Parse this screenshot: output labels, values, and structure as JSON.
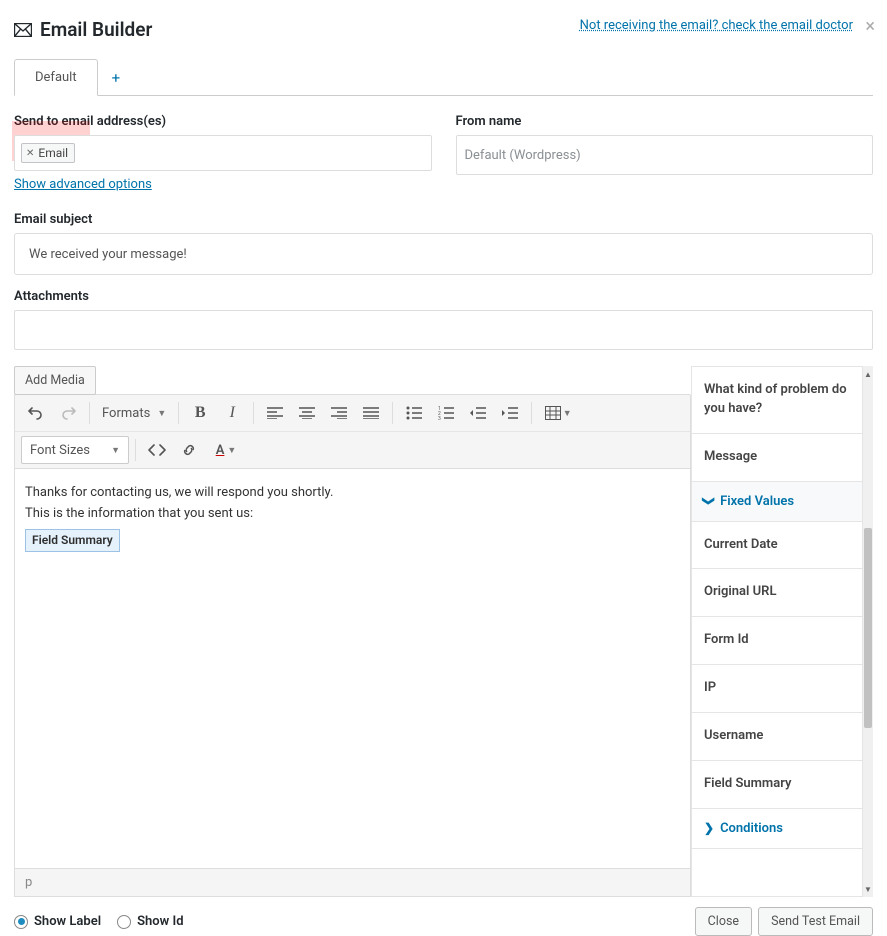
{
  "header": {
    "title": "Email Builder",
    "doctor_link": "Not receiving the email? check the email doctor"
  },
  "tabs": {
    "active": "Default",
    "add_label": "+"
  },
  "labels": {
    "send_to": "Send to email address(es)",
    "from_name": "From name",
    "advanced": "Show advanced options",
    "subject": "Email subject",
    "attachments": "Attachments",
    "add_media": "Add Media"
  },
  "email_tag": "Email",
  "from_name_placeholder": "Default (Wordpress)",
  "subject_value": "We received your message!",
  "toolbar": {
    "formats": "Formats",
    "font_sizes": "Font Sizes"
  },
  "editor": {
    "line1": "Thanks for contacting us, we will respond you shortly.",
    "line2": "This is the information that you sent us:",
    "field_summary": "Field Summary"
  },
  "status_path": "p",
  "side": {
    "problem": "What kind of problem do you have?",
    "message": "Message",
    "fixed_values": "Fixed Values",
    "items": [
      "Current Date",
      "Original URL",
      "Form Id",
      "IP",
      "Username",
      "Field Summary"
    ],
    "conditions": "Conditions"
  },
  "footer": {
    "show_label": "Show Label",
    "show_id": "Show Id",
    "close": "Close",
    "send_test": "Send Test Email"
  }
}
